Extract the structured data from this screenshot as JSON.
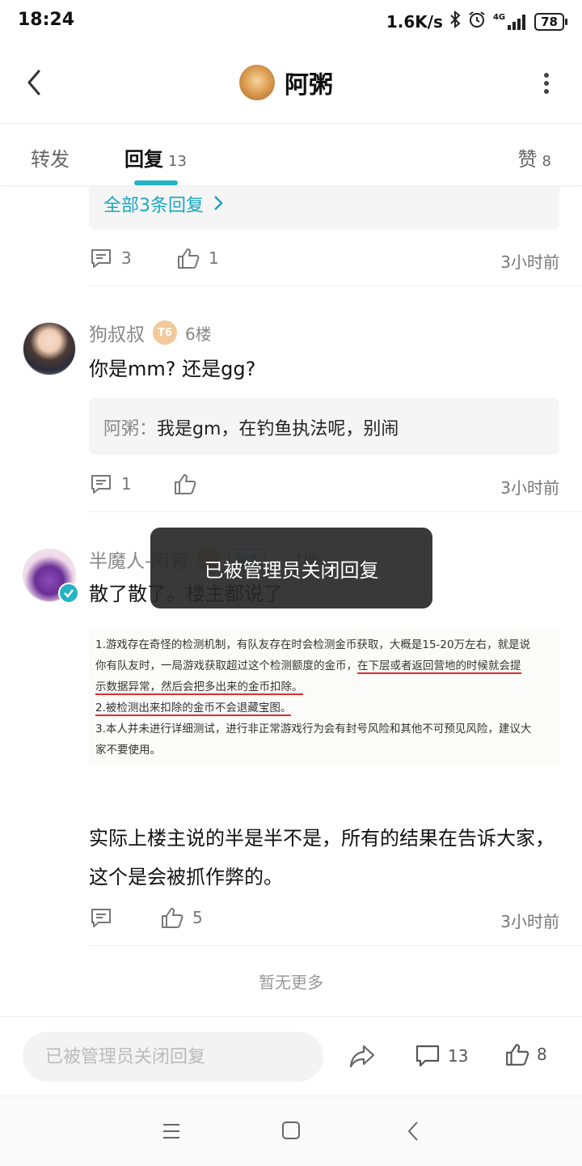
{
  "status_bar": {
    "time": "18:24",
    "net_speed": "1.6K/s",
    "signal_label": "4G",
    "battery": "78"
  },
  "header": {
    "title": "阿粥"
  },
  "tabs": {
    "forward": "转发",
    "reply": "回复",
    "reply_count": "13",
    "like": "赞",
    "like_count": "8"
  },
  "post_top": {
    "all_replies_link": "全部3条回复",
    "comment_count": "3",
    "like_count": "1",
    "time": "3小时前"
  },
  "post_6": {
    "username": "狗叔叔",
    "level_badge": "T6",
    "floor": "6楼",
    "text": "你是mm? 还是gg?",
    "sub_reply_name": "阿粥",
    "sub_reply_text": "我是gm，在钓鱼执法呢，别闹",
    "comment_count": "1",
    "time": "3小时前"
  },
  "post_7": {
    "username": "半魔人-阿紫",
    "badge_role": "版主",
    "floor": "7楼",
    "text": "散了散了。楼主都说了",
    "embedded_lines": [
      "1.游戏存在奇怪的检测机制，有队友存在时会检测金币获取，大概是15-20万左右，就是说",
      "你有队友时，一局游戏获取超过这个检测额度的金币，",
      "在下层或者返回营地的时候就会提",
      "示数据异常，然后会把多出来的金币扣除。",
      "2.被检测出来扣除的金币不会退藏宝图。",
      "3.本人并未进行详细测试，进行非正常游戏行为会有封号风险和其他不可预见风险，建议大",
      "家不要使用。"
    ],
    "text2": "实际上楼主说的半是半不是，所有的结果在告诉大家，这个是会被抓作弊的。",
    "like_count": "5",
    "time": "3小时前"
  },
  "no_more": "暂无更多",
  "toast": "已被管理员关闭回复",
  "bottom_bar": {
    "input_placeholder": "已被管理员关闭回复",
    "comment_count": "13",
    "like_count": "8"
  },
  "colors": {
    "accent": "#24b3c5",
    "link": "#1ba7be",
    "underline_red": "#d9302c"
  }
}
